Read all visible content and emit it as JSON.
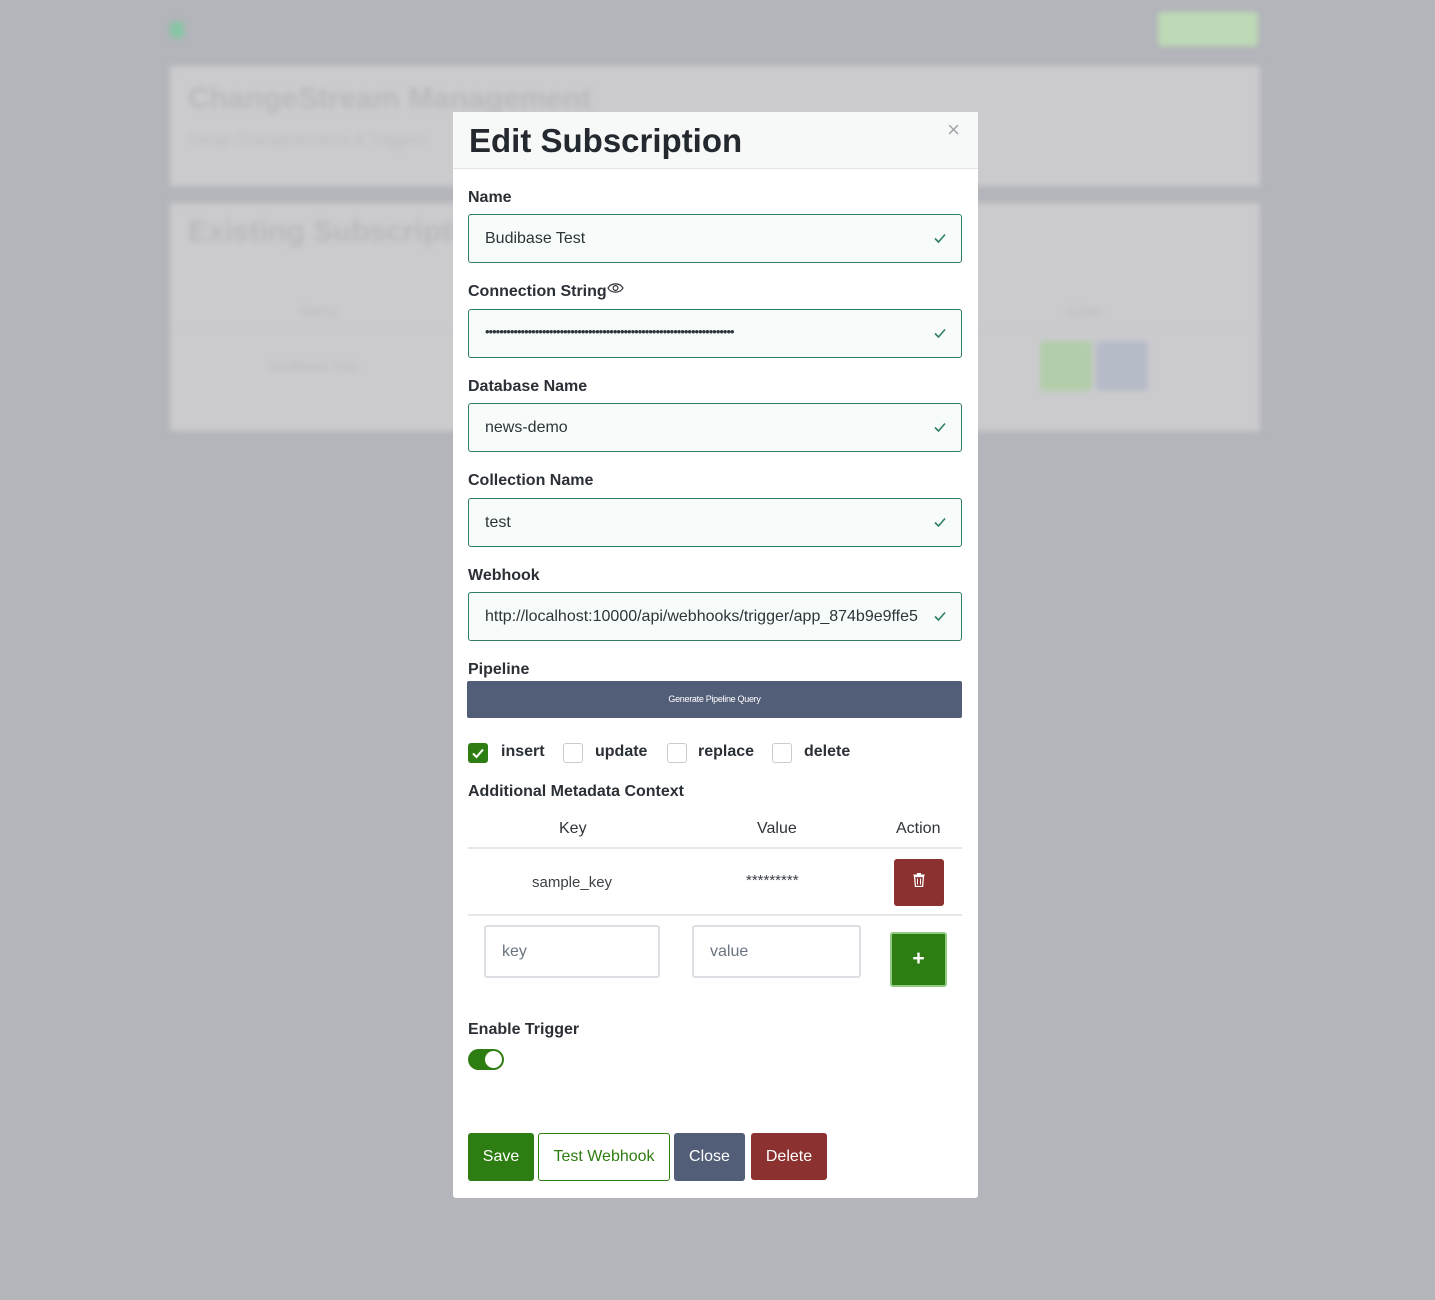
{
  "background": {
    "page_title": "ChangeStream Management",
    "page_subtitle": "Setup ChangeStreams & Triggers",
    "section_title": "Existing Subscriptions",
    "table_header_name": "Name",
    "table_header_action": "Action",
    "row_name": "Budibase Test"
  },
  "modal": {
    "title": "Edit Subscription",
    "close_symbol": "×",
    "name": {
      "label": "Name",
      "value": "Budibase Test"
    },
    "connection_string": {
      "label": "Connection String",
      "value": "••••••••••••••••••••••••••••••••••••••••••••••••••••••••••••••••••••••"
    },
    "database_name": {
      "label": "Database Name",
      "value": "news-demo"
    },
    "collection_name": {
      "label": "Collection Name",
      "value": "test"
    },
    "webhook": {
      "label": "Webhook",
      "value": "http://localhost:10000/api/webhooks/trigger/app_874b9e9ffe5"
    },
    "pipeline": {
      "label": "Pipeline",
      "button_label": "Generate Pipeline Query"
    },
    "operations": [
      {
        "label": "insert",
        "checked": true
      },
      {
        "label": "update",
        "checked": false
      },
      {
        "label": "replace",
        "checked": false
      },
      {
        "label": "delete",
        "checked": false
      }
    ],
    "metadata": {
      "label": "Additional Metadata Context",
      "columns": [
        "Key",
        "Value",
        "Action"
      ],
      "rows": [
        {
          "key": "sample_key",
          "value": "*********"
        }
      ],
      "key_placeholder": "key",
      "value_placeholder": "value",
      "add_label": "+"
    },
    "enable_trigger": {
      "label": "Enable Trigger",
      "enabled": true
    },
    "buttons": {
      "save": "Save",
      "test_webhook": "Test Webhook",
      "close": "Close",
      "delete": "Delete"
    }
  },
  "colors": {
    "primary_green": "#2e7d12",
    "danger_red": "#8b3230",
    "slate": "#525e78",
    "valid_border": "#2f7d63"
  }
}
